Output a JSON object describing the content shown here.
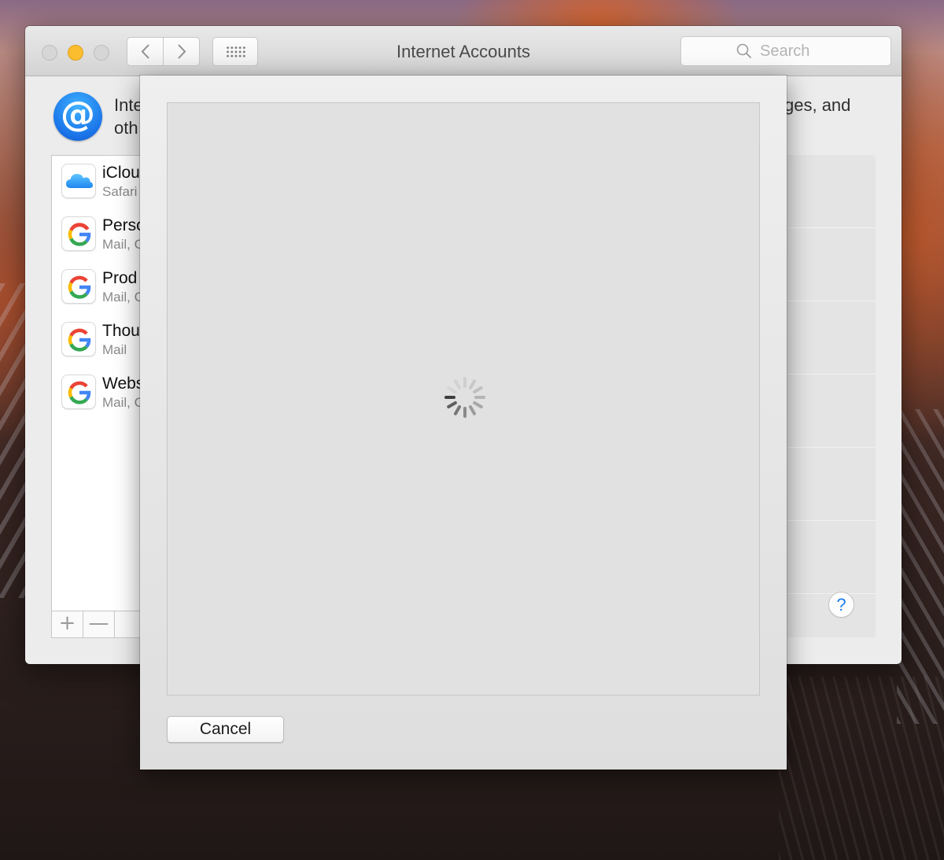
{
  "window": {
    "title": "Internet Accounts",
    "search_placeholder": "Search"
  },
  "header": {
    "description_line1": "Inte",
    "description_line2": "oth",
    "description_right": "ges, and"
  },
  "accounts": [
    {
      "name": "iClou",
      "services": "Safari",
      "icon": "icloud-icon"
    },
    {
      "name": "Perso",
      "services": "Mail, C",
      "icon": "google-icon"
    },
    {
      "name": "Prod",
      "services": "Mail, C",
      "icon": "google-icon"
    },
    {
      "name": "Thou",
      "services": "Mail",
      "icon": "google-icon"
    },
    {
      "name": "Webs",
      "services": "Mail, C",
      "icon": "google-icon"
    }
  ],
  "list_controls": {
    "add": "+",
    "remove": "—"
  },
  "help": "?",
  "sheet": {
    "cancel_label": "Cancel",
    "loading": true
  },
  "colors": {
    "minimize": "#fbbd2e",
    "accent_blue": "#1a7ff0",
    "google_blue": "#4285F4",
    "google_red": "#EA4335",
    "google_yellow": "#FBBC05",
    "google_green": "#34A853"
  }
}
